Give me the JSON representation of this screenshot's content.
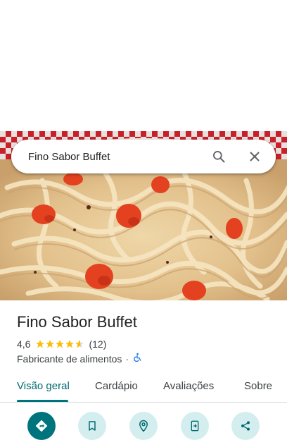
{
  "search": {
    "query": "Fino Sabor Buffet"
  },
  "place": {
    "name": "Fino Sabor Buffet",
    "rating": "4,6",
    "stars": 4.6,
    "review_count": "(12)",
    "category": "Fabricante de alimentos",
    "separator": "·"
  },
  "tabs": [
    {
      "label": "Visão geral",
      "active": true
    },
    {
      "label": "Cardápio"
    },
    {
      "label": "Avaliações"
    },
    {
      "label": "Sobre"
    }
  ],
  "icons": {
    "search": "search-icon",
    "close": "close-icon",
    "accessibility": "wheelchair-icon",
    "actions": [
      "directions-icon",
      "save-icon",
      "nearby-icon",
      "send-to-phone-icon",
      "share-icon"
    ]
  },
  "colors": {
    "accent": "#00747c",
    "action_bg": "#d4eef0",
    "star": "#fbbc04",
    "accessibility": "#1a73e8"
  }
}
